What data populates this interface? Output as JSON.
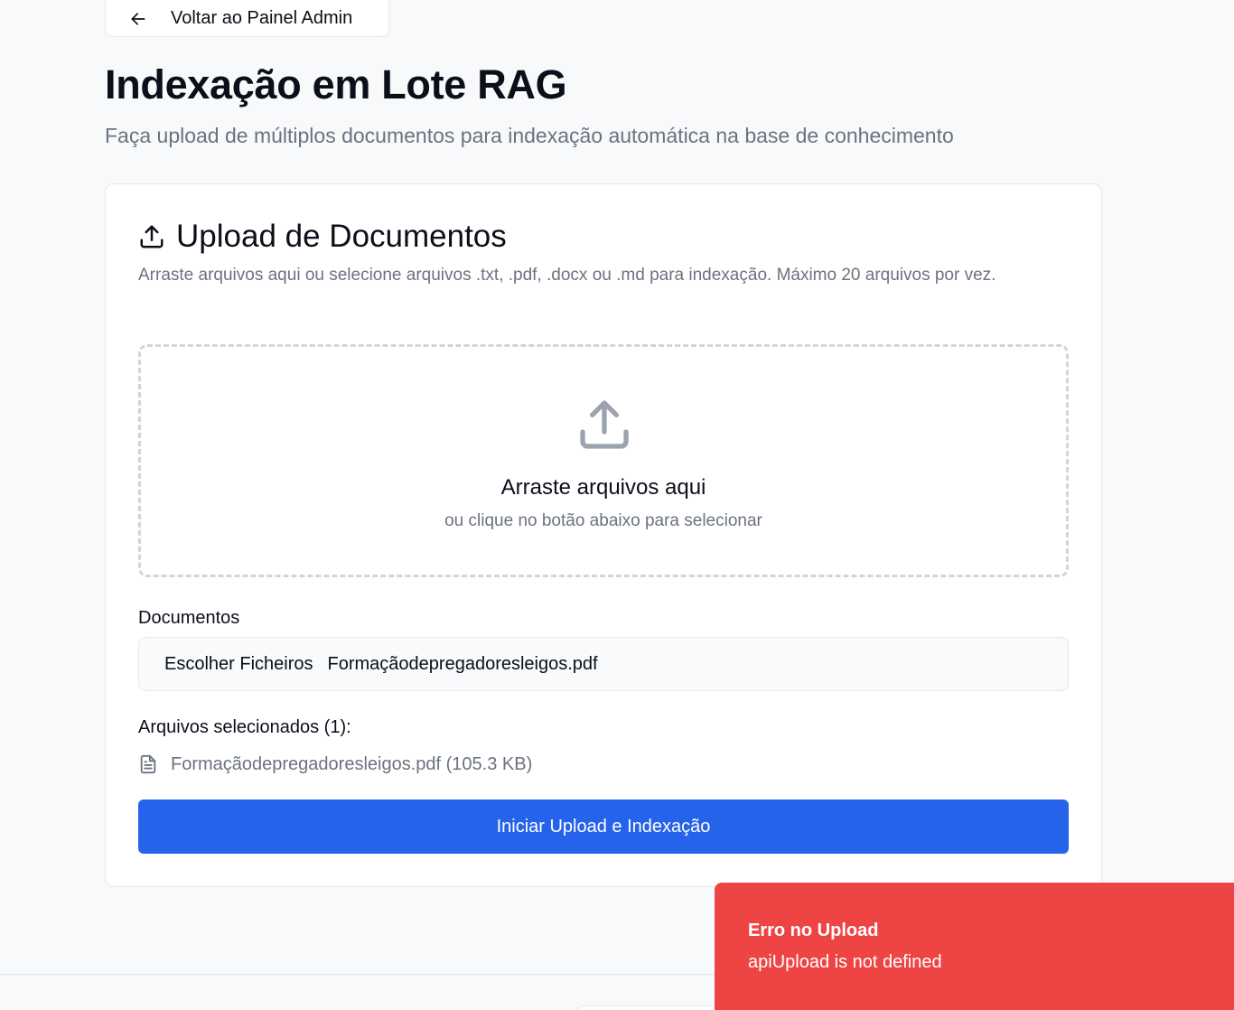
{
  "back_button": {
    "label": "Voltar ao Painel Admin"
  },
  "page": {
    "title": "Indexação em Lote RAG",
    "subtitle": "Faça upload de múltiplos documentos para indexação automática na base de conhecimento"
  },
  "upload_card": {
    "title": "Upload de Documentos",
    "description": "Arraste arquivos aqui ou selecione arquivos .txt, .pdf, .docx ou .md para indexação. Máximo 20 arquivos por vez.",
    "dropzone": {
      "title": "Arraste arquivos aqui",
      "subtitle": "ou clique no botão abaixo para selecionar"
    },
    "documents_label": "Documentos",
    "file_input": {
      "choose_label": "Escolher Ficheiros",
      "file_name": "Formaçãodepregadoresleigos.pdf"
    },
    "selected_label": "Arquivos selecionados (1):",
    "selected_files": [
      {
        "text": "Formaçãodepregadoresleigos.pdf (105.3 KB)"
      }
    ],
    "submit_label": "Iniciar Upload e Indexação"
  },
  "toast": {
    "title": "Erro no Upload",
    "message": "apiUpload is not defined"
  },
  "icons": {
    "back": "arrow-left-icon",
    "upload": "upload-icon",
    "file": "file-text-icon"
  },
  "colors": {
    "primary": "#2563eb",
    "error": "#ef4444",
    "muted_text": "#6b7280",
    "background": "#f8f9fb"
  }
}
